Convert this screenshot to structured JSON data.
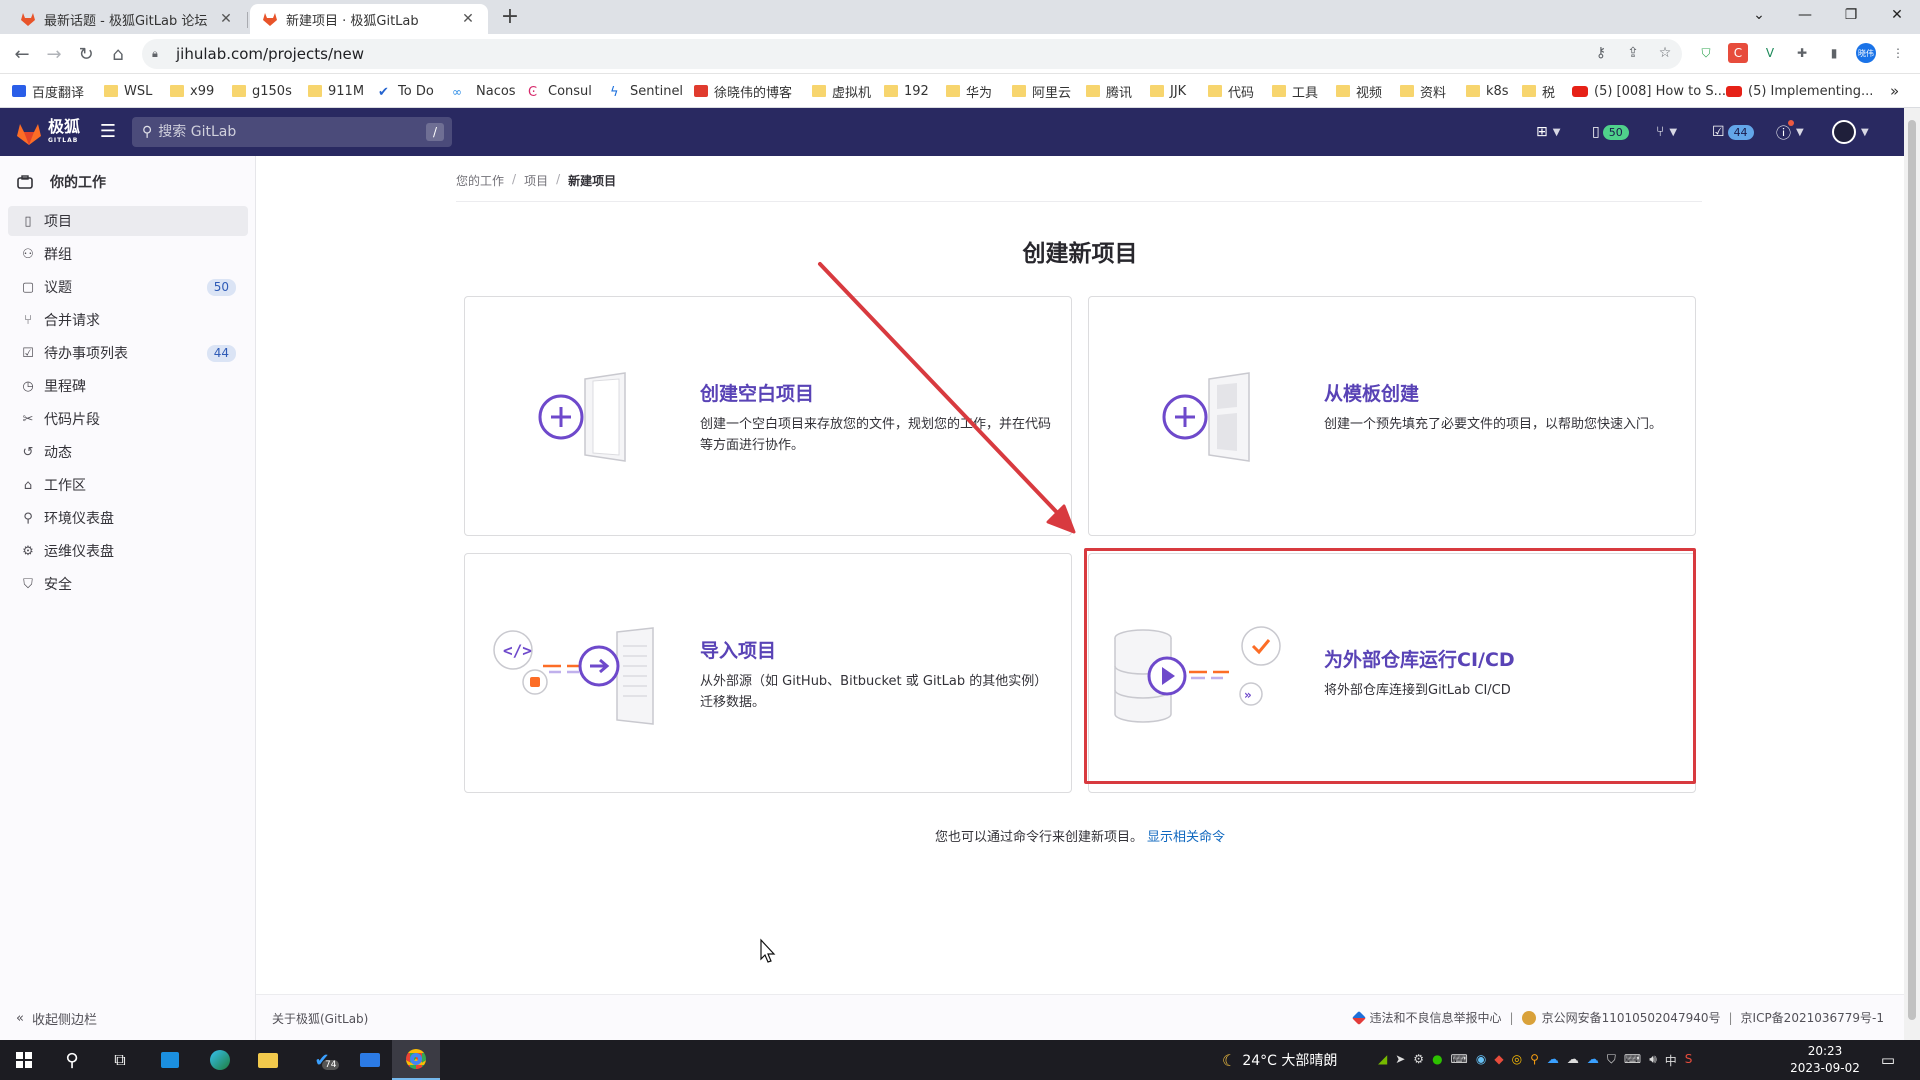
{
  "browser": {
    "tabs": [
      {
        "title": "最新话题 - 极狐GitLab 论坛",
        "active": false
      },
      {
        "title": "新建项目 · 极狐GitLab",
        "active": true
      }
    ],
    "new_tab": "+",
    "url": "jihulab.com/projects/new",
    "bookmarks": [
      {
        "label": "百度翻译",
        "icon": "translate-icon"
      },
      {
        "label": "WSL",
        "icon": "folder-icon"
      },
      {
        "label": "x99",
        "icon": "folder-icon"
      },
      {
        "label": "g150s",
        "icon": "folder-icon"
      },
      {
        "label": "911M",
        "icon": "folder-icon"
      },
      {
        "label": "To Do",
        "icon": "check-icon"
      },
      {
        "label": "Nacos",
        "icon": "nacos-icon"
      },
      {
        "label": "Consul",
        "icon": "consul-icon"
      },
      {
        "label": "Sentinel",
        "icon": "sentinel-icon"
      },
      {
        "label": "徐晓伟的博客",
        "icon": "blog-icon"
      },
      {
        "label": "虚拟机",
        "icon": "folder-icon"
      },
      {
        "label": "192",
        "icon": "folder-icon"
      },
      {
        "label": "华为",
        "icon": "folder-icon"
      },
      {
        "label": "阿里云",
        "icon": "folder-icon"
      },
      {
        "label": "腾讯",
        "icon": "folder-icon"
      },
      {
        "label": "JJK",
        "icon": "folder-icon"
      },
      {
        "label": "代码",
        "icon": "folder-icon"
      },
      {
        "label": "工具",
        "icon": "folder-icon"
      },
      {
        "label": "视频",
        "icon": "folder-icon"
      },
      {
        "label": "资料",
        "icon": "folder-icon"
      },
      {
        "label": "k8s",
        "icon": "folder-icon"
      },
      {
        "label": "税",
        "icon": "folder-icon"
      },
      {
        "label": "(5) [008] How to S...",
        "icon": "youtube-icon"
      },
      {
        "label": "(5) Implementing...",
        "icon": "youtube-icon"
      }
    ],
    "bookmarks_more": "»",
    "profile_initials": "晓伟"
  },
  "header": {
    "logo_text": "极狐",
    "logo_sub": "GITLAB",
    "search_placeholder": "搜索 GitLab",
    "search_shortcut": "/",
    "issues_count": "50",
    "todos_count": "44"
  },
  "sidebar": {
    "context_title": "你的工作",
    "items": [
      {
        "label": "项目",
        "icon": "project-icon",
        "active": true,
        "count": ""
      },
      {
        "label": "群组",
        "icon": "group-icon",
        "active": false,
        "count": ""
      },
      {
        "label": "议题",
        "icon": "issues-icon",
        "active": false,
        "count": "50"
      },
      {
        "label": "合并请求",
        "icon": "merge-request-icon",
        "active": false,
        "count": ""
      },
      {
        "label": "待办事项列表",
        "icon": "todo-icon",
        "active": false,
        "count": "44"
      },
      {
        "label": "里程碑",
        "icon": "milestone-icon",
        "active": false,
        "count": ""
      },
      {
        "label": "代码片段",
        "icon": "snippet-icon",
        "active": false,
        "count": ""
      },
      {
        "label": "动态",
        "icon": "activity-icon",
        "active": false,
        "count": ""
      },
      {
        "label": "工作区",
        "icon": "workspace-icon",
        "active": false,
        "count": ""
      },
      {
        "label": "环境仪表盘",
        "icon": "environment-icon",
        "active": false,
        "count": ""
      },
      {
        "label": "运维仪表盘",
        "icon": "operations-icon",
        "active": false,
        "count": ""
      },
      {
        "label": "安全",
        "icon": "shield-icon",
        "active": false,
        "count": ""
      }
    ],
    "collapse_label": "收起侧边栏"
  },
  "main": {
    "breadcrumb": [
      "您的工作",
      "项目",
      "新建项目"
    ],
    "title": "创建新项目",
    "panels": [
      {
        "title": "创建空白项目",
        "desc": "创建一个空白项目来存放您的文件，规划您的工作，并在代码等方面进行协作。"
      },
      {
        "title": "从模板创建",
        "desc": "创建一个预先填充了必要文件的项目，以帮助您快速入门。"
      },
      {
        "title": "导入项目",
        "desc": "从外部源（如 GitHub、Bitbucket 或 GitLab 的其他实例）迁移数据。"
      },
      {
        "title": "为外部仓库运行CI/CD",
        "desc": "将外部仓库连接到GitLab CI/CD"
      }
    ],
    "cli_hint": "您也可以通过命令行来创建新项目。",
    "cli_link": "显示相关命令"
  },
  "footer": {
    "about": "关于极狐(GitLab)",
    "report": "违法和不良信息举报中心",
    "police": "京公网安备11010502047940号",
    "icp": "京ICP备2021036779号-1"
  },
  "taskbar": {
    "mail_badge": "74",
    "weather": "24°C 大部晴朗",
    "ime": "中",
    "time": "20:23",
    "date": "2023-09-02"
  },
  "colors": {
    "header_bg": "#292961",
    "accent_purple": "#5943b6",
    "annotation_red": "#d83a3f",
    "link_blue": "#1068bf"
  }
}
